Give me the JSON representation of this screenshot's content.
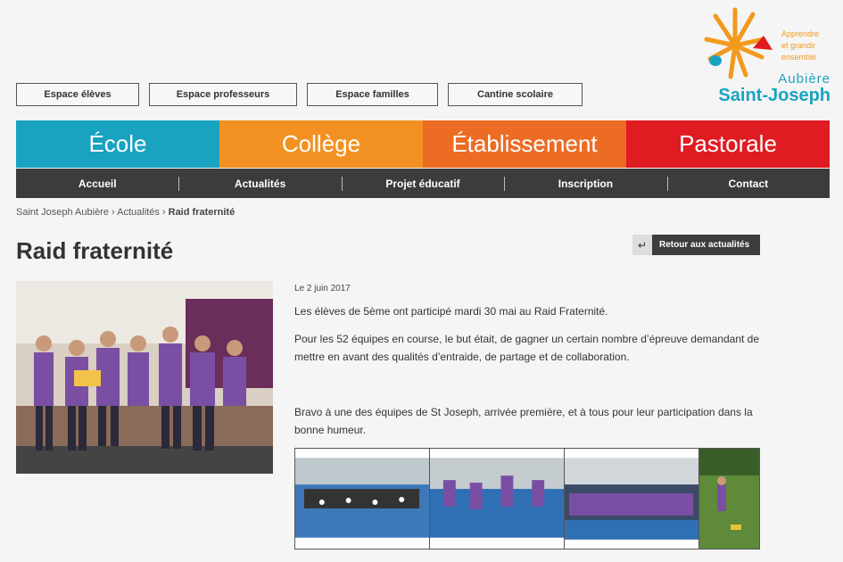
{
  "top_buttons": [
    "Espace élèves",
    "Espace professeurs",
    "Espace familles",
    "Cantine scolaire"
  ],
  "logo": {
    "tagline": [
      "Apprendre",
      "et grandir",
      "ensemble"
    ],
    "town": "Aubière",
    "name": "Saint-Joseph"
  },
  "color_nav": [
    {
      "label": "École",
      "color": "#19a3c1"
    },
    {
      "label": "Collège",
      "color": "#f29122"
    },
    {
      "label": "Établissement",
      "color": "#ec6c24"
    },
    {
      "label": "Pastorale",
      "color": "#e01b22"
    }
  ],
  "menu": [
    "Accueil",
    "Actualités",
    "Projet éducatif",
    "Inscription",
    "Contact"
  ],
  "breadcrumb": {
    "part1": "Saint Joseph Aubière",
    "part2": "Actualités",
    "current": "Raid fraternité"
  },
  "article": {
    "title": "Raid fraternité",
    "back_label": "Retour aux actualités",
    "date": "Le 2 juin 2017",
    "para1": "Les élèves de 5ème ont participé mardi 30 mai au Raid Fraternité.",
    "para2": "Pour les 52 équipes en course, le but était, de gagner un certain nombre d’épreuve demandant de mettre en avant des qualités d’entraide, de partage et de collaboration.",
    "para3": "Bravo à une des équipes de St Joseph, arrivée première, et à tous pour leur participation dans la bonne humeur."
  }
}
